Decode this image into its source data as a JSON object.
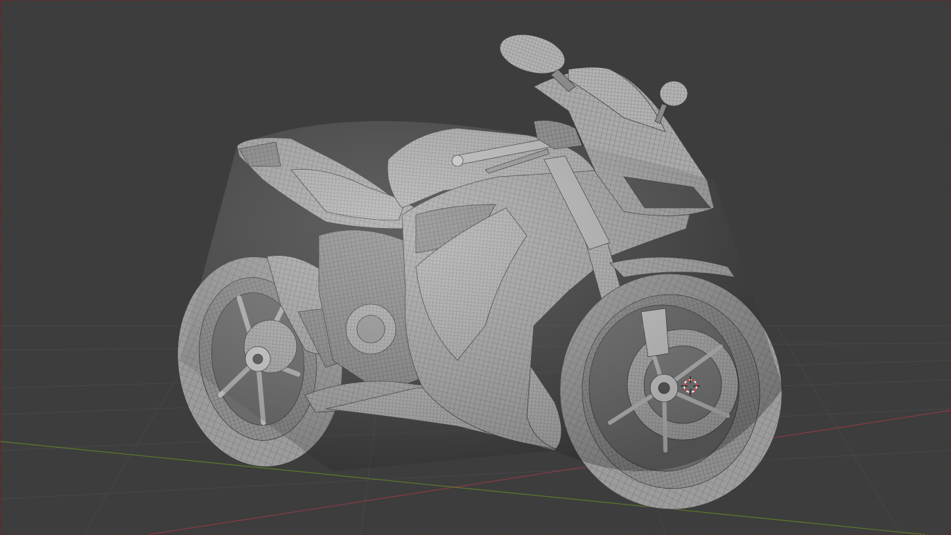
{
  "viewport": {
    "mode": "3D Viewport",
    "shading": "solid",
    "overlay": "wireframe",
    "object_name": "motorcycle-model",
    "colors": {
      "background": "#3d3d3d",
      "grid": "#474747",
      "x_axis": "#8a3a45",
      "y_axis": "#5c7a2a",
      "mesh_fill": "#a8a8a8",
      "mesh_dark": "#6e6e6e",
      "wire": "#3a3a3a",
      "cursor_red": "#d83a3a",
      "cursor_white": "#f0f0f0"
    }
  }
}
